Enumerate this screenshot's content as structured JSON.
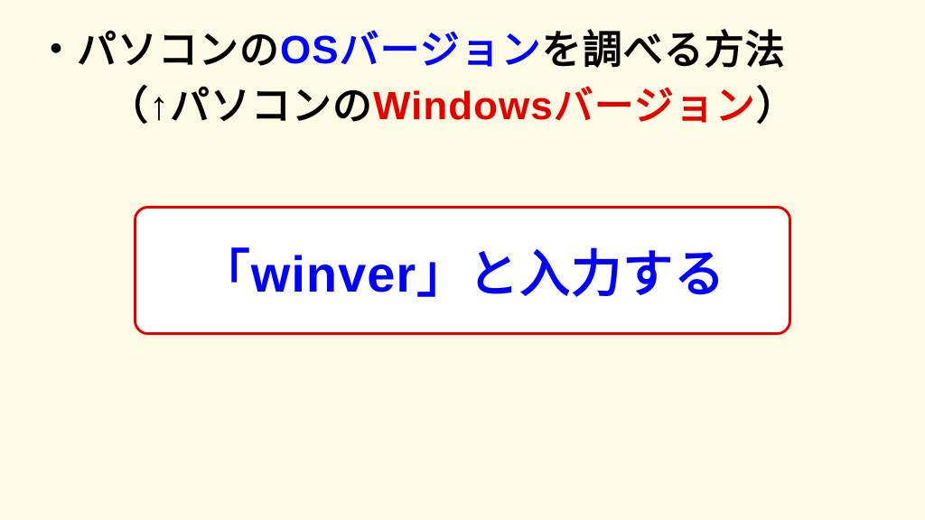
{
  "heading": {
    "line1_part1": "・パソコンの",
    "line1_os": "OSバージョン",
    "line1_part2": "を調べる方法",
    "line2_part1": "（↑パソコンの",
    "line2_windows": "Windowsバージョン",
    "line2_part2": "）"
  },
  "instruction": {
    "text": "「winver」と入力する"
  },
  "colors": {
    "background": "#fdfae5",
    "black": "#000000",
    "blue": "#0000ff",
    "red": "#e50000",
    "white": "#ffffff"
  }
}
